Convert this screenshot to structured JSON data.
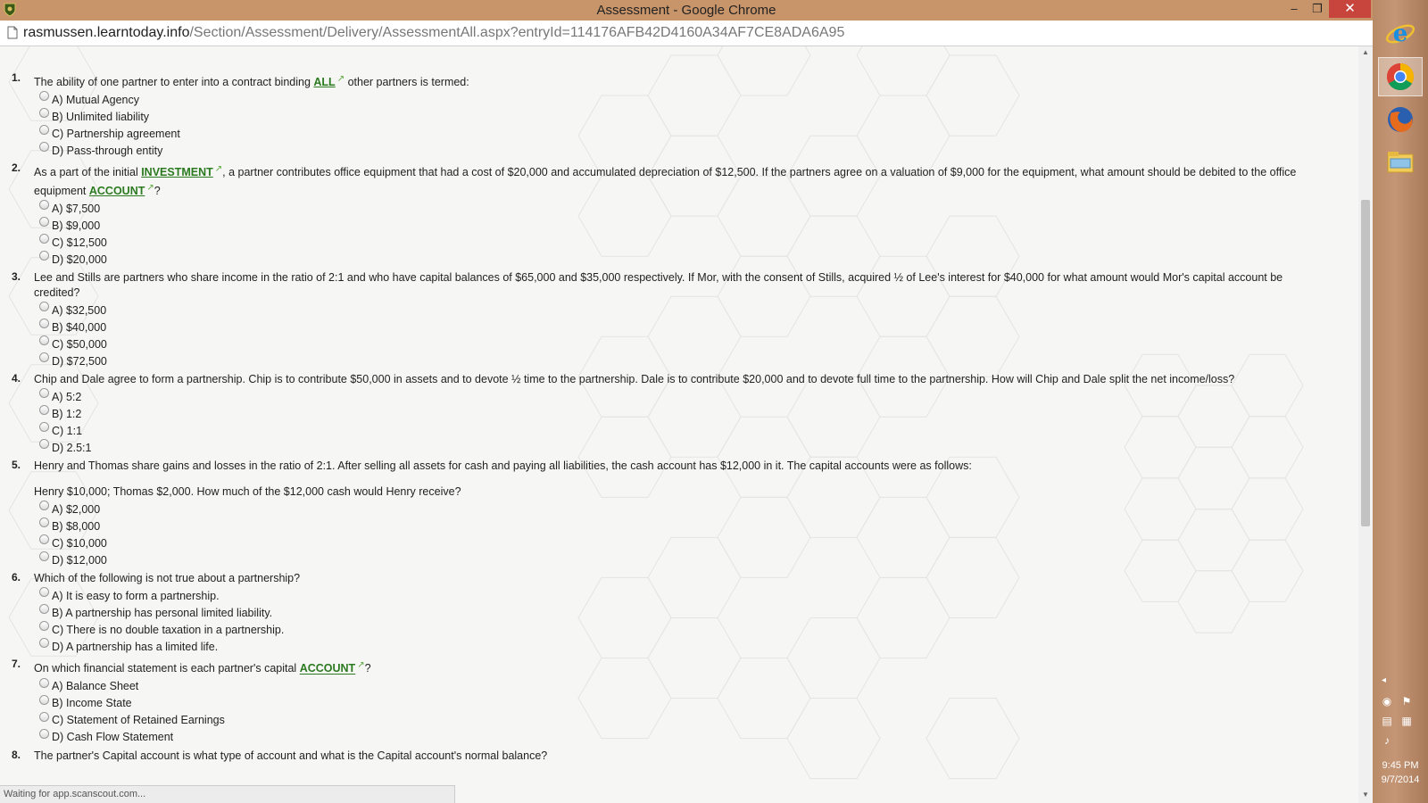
{
  "window": {
    "title": "Assessment - Google Chrome",
    "minimize": "‒",
    "restore": "❐",
    "close": "✕"
  },
  "address": {
    "host": "rasmussen.learntoday.info",
    "path": "/Section/Assessment/Delivery/AssessmentAll.aspx?entryId=114176AFB42D4160A34AF7CE8ADA6A95"
  },
  "questions": [
    {
      "num": "1.",
      "pre": "The ability of one partner to enter into a contract binding ",
      "kw": "ALL",
      "post": " other partners is termed:",
      "options": [
        "A) Mutual Agency",
        "B) Unlimited liability",
        "C) Partnership agreement",
        "D) Pass-through entity"
      ]
    },
    {
      "num": "2.",
      "pre": "As a part of the initial ",
      "kw": "INVESTMENT",
      "mid": ", a partner contributes office equipment that had a cost of $20,000 and accumulated depreciation of $12,500. If the partners agree on a valuation of $9,000 for the equipment, what amount should be debited to the office equipment ",
      "kw2": "ACCOUNT",
      "post": "?",
      "options": [
        "A) $7,500",
        "B) $9,000",
        "C) $12,500",
        "D) $20,000"
      ]
    },
    {
      "num": "3.",
      "text": "Lee and Stills are partners who share income in the ratio of 2:1 and who have capital balances of $65,000 and $35,000 respectively. If Mor, with the consent of Stills, acquired ½ of Lee's interest for $40,000 for what amount would Mor's capital account be credited?",
      "options": [
        "A) $32,500",
        "B) $40,000",
        "C) $50,000",
        "D) $72,500"
      ]
    },
    {
      "num": "4.",
      "text": "Chip and Dale agree to form a partnership. Chip is to contribute $50,000 in assets and to devote ½ time to the partnership. Dale is to contribute $20,000 and to devote full time to the partnership. How will Chip and Dale split the net income/loss?",
      "options": [
        "A) 5:2",
        "B) 1:2",
        "C) 1:1",
        "D) 2.5:1"
      ]
    },
    {
      "num": "5.",
      "text": "Henry and Thomas share gains and losses in the ratio of 2:1. After selling all assets for cash and paying all liabilities, the cash account has $12,000 in it. The capital accounts were as follows:",
      "text2": "Henry $10,000; Thomas $2,000. How much of the $12,000 cash would Henry receive?",
      "options": [
        "A) $2,000",
        "B) $8,000",
        "C) $10,000",
        "D) $12,000"
      ]
    },
    {
      "num": "6.",
      "text": "Which of the following is not true about a partnership?",
      "options": [
        "A) It is easy to form a partnership.",
        "B) A partnership has personal limited liability.",
        "C) There is no double taxation in a partnership.",
        "D) A partnership has a limited life."
      ]
    },
    {
      "num": "7.",
      "pre": "On which financial statement is each partner's capital ",
      "kw": "ACCOUNT",
      "post": "?",
      "options": [
        "A) Balance Sheet",
        "B) Income State",
        "C) Statement of Retained Earnings",
        "D) Cash Flow Statement"
      ]
    },
    {
      "num": "8.",
      "text": "The partner's Capital account is what type of account and what is the Capital account's normal balance?",
      "options": []
    }
  ],
  "status": "Waiting for app.scanscout.com...",
  "taskbar": {
    "apps": [
      "ie-icon",
      "chrome-icon",
      "firefox-icon",
      "file-explorer-icon"
    ],
    "time": "9:45 PM",
    "date": "9/7/2014"
  }
}
